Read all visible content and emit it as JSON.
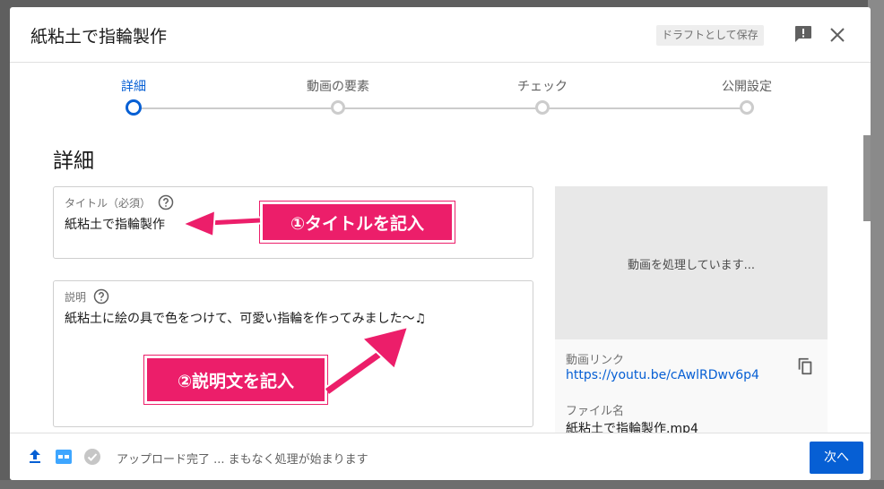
{
  "window": {
    "title": "紙粘土で指輪製作",
    "draft_button": "ドラフトとして保存"
  },
  "icons": {
    "feedback": "feedback-icon",
    "close": "close-icon",
    "help": "help-icon",
    "copy": "copy-icon",
    "upload": "upload-icon",
    "hd": "hd-icon",
    "check": "check-circle-icon"
  },
  "steps": [
    {
      "label": "詳細",
      "active": true
    },
    {
      "label": "動画の要素",
      "active": false
    },
    {
      "label": "チェック",
      "active": false
    },
    {
      "label": "公開設定",
      "active": false
    }
  ],
  "section_title": "詳細",
  "title_field": {
    "label": "タイトル（必須）",
    "value": "紙粘土で指輪製作"
  },
  "description_field": {
    "label": "説明",
    "value": "紙粘土に絵の具で色をつけて、可愛い指輪を作ってみました〜♫"
  },
  "preview": {
    "status": "動画を処理しています...",
    "link_label": "動画リンク",
    "link_value": "https://youtu.be/cAwlRDwv6p4",
    "file_label": "ファイル名",
    "file_value": "紙粘土で指輪製作.mp4"
  },
  "footer": {
    "status": "アップロード完了 ... まもなく処理が始まります",
    "next_button": "次へ"
  },
  "annotations": {
    "callout_1": "①タイトルを記入",
    "callout_2": "②説明文を記入"
  },
  "colors": {
    "accent": "#065fd4",
    "callout": "#ec1e6a"
  }
}
